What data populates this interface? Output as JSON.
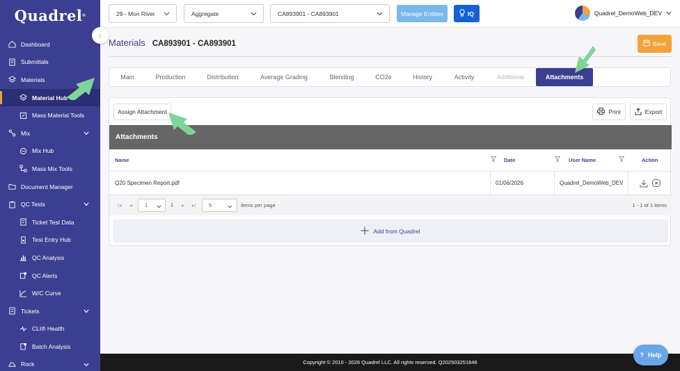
{
  "app": {
    "logo": "Quadrel",
    "logo_mark": "®"
  },
  "sidebar": {
    "items": [
      {
        "label": "Dashboard"
      },
      {
        "label": "Submittals"
      },
      {
        "label": "Materials"
      },
      {
        "label": "Material Hub"
      },
      {
        "label": "Mass Material Tools"
      },
      {
        "label": "Mix"
      },
      {
        "label": "Mix Hub"
      },
      {
        "label": "Mass Mix Tools"
      },
      {
        "label": "Document Manager"
      },
      {
        "label": "QC Tests"
      },
      {
        "label": "Ticket Test Data"
      },
      {
        "label": "Test Entry Hub"
      },
      {
        "label": "QC Analysis"
      },
      {
        "label": "QC Alerts"
      },
      {
        "label": "W/C Curve"
      },
      {
        "label": "Tickets"
      },
      {
        "label": "CLI® Health"
      },
      {
        "label": "Batch Analysis"
      },
      {
        "label": "Rock"
      }
    ]
  },
  "topbar": {
    "plant": "29 - Mon River",
    "material_type": "Aggregate",
    "material": "CA893901 - CA893901",
    "manage_label": "Manage Entities",
    "iq_label": "IQ",
    "user_name": "Quadrel_DemoWeb_DEV"
  },
  "page": {
    "title": "Materials",
    "code": "CA893901 - CA893901",
    "save_label": "Save"
  },
  "tabs": [
    {
      "label": "Main"
    },
    {
      "label": "Production"
    },
    {
      "label": "Distribution"
    },
    {
      "label": "Average Grading"
    },
    {
      "label": "Blending"
    },
    {
      "label": "CO2e"
    },
    {
      "label": "History"
    },
    {
      "label": "Activity"
    },
    {
      "label": "Additional"
    },
    {
      "label": "Attachments"
    }
  ],
  "attachments": {
    "assign_label": "Assign Attachment",
    "print_label": "Print",
    "export_label": "Export",
    "grid_title": "Attachments",
    "columns": {
      "name": "Name",
      "date": "Date",
      "user": "User Name",
      "action": "Action"
    },
    "rows": [
      {
        "name": "Q20 Specimen Report.pdf",
        "date": "01/06/2026",
        "user": "Quadrel_DemoWeb_DEV"
      }
    ],
    "pager": {
      "page": "1",
      "current": "1",
      "page_size": "5",
      "per_page_label": "items per page",
      "summary": "1 - 1 of 1 items"
    },
    "add_label": "Add from Quadrel"
  },
  "footer": {
    "copyright": "Copyright © 2010 - 2026 Quadrel LLC. All rights reserved. Q202503251646"
  },
  "help": {
    "label": "Help"
  },
  "colors": {
    "primary": "#3c3f91",
    "accent": "#f3a13a",
    "arrow": "#7fd49a"
  }
}
